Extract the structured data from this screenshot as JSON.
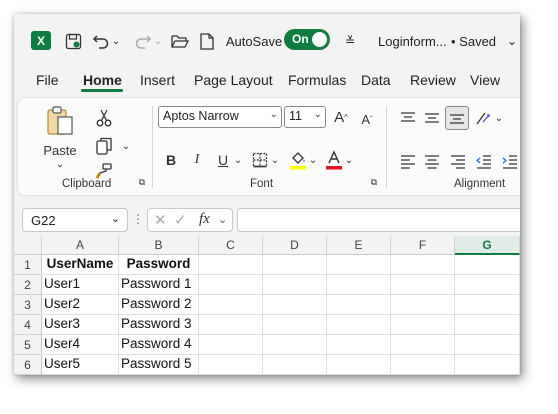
{
  "titlebar": {
    "logo_letter": "X",
    "autosave_label": "AutoSave",
    "autosave_state": "On",
    "filename": "Loginform...",
    "saved_status": "• Saved",
    "chevron": "⌄"
  },
  "tabs": [
    "File",
    "Home",
    "Insert",
    "Page Layout",
    "Formulas",
    "Data",
    "Review",
    "View"
  ],
  "active_tab": "Home",
  "ribbon": {
    "clipboard": {
      "label": "Clipboard",
      "paste_label": "Paste"
    },
    "font": {
      "label": "Font",
      "font_name": "Aptos Narrow",
      "font_size": "11",
      "bold": "B",
      "italic": "I",
      "underline": "U",
      "grow": "A",
      "shrink": "A"
    },
    "alignment": {
      "label": "Alignment"
    }
  },
  "formula_bar": {
    "name_box": "G22",
    "fx": "fx",
    "value": ""
  },
  "sheet": {
    "columns": [
      "A",
      "B",
      "C",
      "D",
      "E",
      "F",
      "G"
    ],
    "selected_column": "G",
    "rows": [
      "1",
      "2",
      "3",
      "4",
      "5",
      "6"
    ],
    "cells": [
      [
        "UserName",
        "Password"
      ],
      [
        "User1",
        "Password 1"
      ],
      [
        "User2",
        "Password 2"
      ],
      [
        "User3",
        "Password 3"
      ],
      [
        "User4",
        "Password 4"
      ],
      [
        "User5",
        "Password 5"
      ]
    ]
  },
  "colors": {
    "accent": "#107c41",
    "font_highlight": "#ffff00",
    "font_color": "#e81123"
  }
}
